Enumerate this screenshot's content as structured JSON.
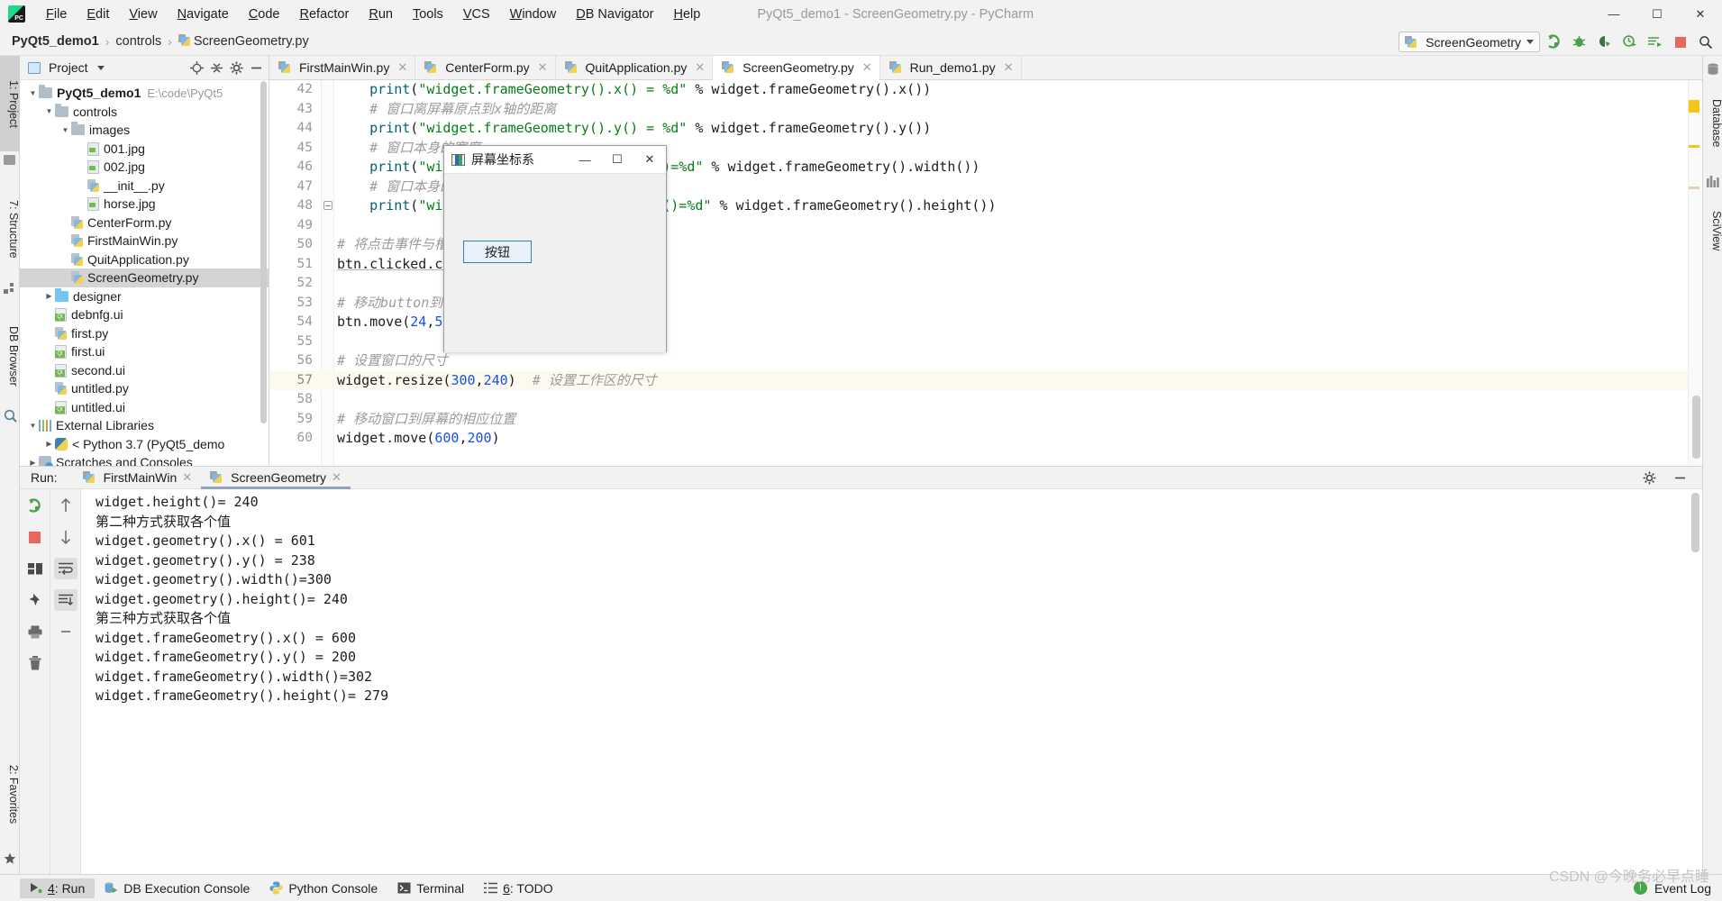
{
  "titlebar": {
    "app_icon": "pycharm-logo-icon",
    "menus": [
      "File",
      "Edit",
      "View",
      "Navigate",
      "Code",
      "Refactor",
      "Run",
      "Tools",
      "VCS",
      "Window",
      "DB Navigator",
      "Help"
    ],
    "window_title": "PyQt5_demo1 - ScreenGeometry.py - PyCharm",
    "minimize": "—",
    "maximize": "☐",
    "close": "✕"
  },
  "navbar": {
    "breadcrumbs": [
      "PyQt5_demo1",
      "controls",
      "ScreenGeometry.py"
    ],
    "separator": "›",
    "run_config": {
      "name": "ScreenGeometry",
      "dropdown": "▾"
    },
    "toolbar_icons": [
      "run-icon",
      "debug-icon",
      "coverage-icon",
      "profile-icon",
      "run-with-console-icon",
      "stop-icon",
      "search-everywhere-icon"
    ]
  },
  "left_strip": {
    "tabs": [
      "1: Project",
      "7: Structure",
      "DB Browser",
      "2: Favorites"
    ]
  },
  "right_strip": {
    "tabs": [
      "Database",
      "SciView"
    ]
  },
  "project_panel": {
    "title": "Project",
    "dropdown": "▾",
    "header_icons": [
      "locate-icon",
      "collapse-all-icon",
      "settings-gear-icon",
      "hide-icon"
    ],
    "tree": [
      {
        "label": "PyQt5_demo1",
        "path": "E:\\code\\PyQt5",
        "icon": "folder-icon",
        "depth": 0,
        "arrow": "▼",
        "bold": true,
        "selected": false
      },
      {
        "label": "controls",
        "path": "",
        "icon": "folder-icon",
        "depth": 1,
        "arrow": "▼",
        "bold": false,
        "selected": false
      },
      {
        "label": "images",
        "path": "",
        "icon": "folder-icon",
        "depth": 2,
        "arrow": "▼",
        "bold": false,
        "selected": false
      },
      {
        "label": "001.jpg",
        "path": "",
        "icon": "image-file-icon",
        "depth": 3,
        "arrow": "",
        "bold": false,
        "selected": false
      },
      {
        "label": "002.jpg",
        "path": "",
        "icon": "image-file-icon",
        "depth": 3,
        "arrow": "",
        "bold": false,
        "selected": false
      },
      {
        "label": "__init__.py",
        "path": "",
        "icon": "python-file-icon",
        "depth": 3,
        "arrow": "",
        "bold": false,
        "selected": false
      },
      {
        "label": "horse.jpg",
        "path": "",
        "icon": "image-file-icon",
        "depth": 3,
        "arrow": "",
        "bold": false,
        "selected": false
      },
      {
        "label": "CenterForm.py",
        "path": "",
        "icon": "python-file-icon",
        "depth": 2,
        "arrow": "",
        "bold": false,
        "selected": false
      },
      {
        "label": "FirstMainWin.py",
        "path": "",
        "icon": "python-file-icon",
        "depth": 2,
        "arrow": "",
        "bold": false,
        "selected": false
      },
      {
        "label": "QuitApplication.py",
        "path": "",
        "icon": "python-file-icon",
        "depth": 2,
        "arrow": "",
        "bold": false,
        "selected": false
      },
      {
        "label": "ScreenGeometry.py",
        "path": "",
        "icon": "python-file-icon",
        "depth": 2,
        "arrow": "",
        "bold": false,
        "selected": true
      },
      {
        "label": "designer",
        "path": "",
        "icon": "folder-blue-icon",
        "depth": 1,
        "arrow": "▶",
        "bold": false,
        "selected": false
      },
      {
        "label": "debnfg.ui",
        "path": "",
        "icon": "qt-ui-file-icon",
        "depth": 1,
        "arrow": "",
        "bold": false,
        "selected": false
      },
      {
        "label": "first.py",
        "path": "",
        "icon": "python-file-icon",
        "depth": 1,
        "arrow": "",
        "bold": false,
        "selected": false
      },
      {
        "label": "first.ui",
        "path": "",
        "icon": "qt-ui-file-icon",
        "depth": 1,
        "arrow": "",
        "bold": false,
        "selected": false
      },
      {
        "label": "second.ui",
        "path": "",
        "icon": "qt-ui-file-icon",
        "depth": 1,
        "arrow": "",
        "bold": false,
        "selected": false
      },
      {
        "label": "untitled.py",
        "path": "",
        "icon": "python-file-icon",
        "depth": 1,
        "arrow": "",
        "bold": false,
        "selected": false
      },
      {
        "label": "untitled.ui",
        "path": "",
        "icon": "qt-ui-file-icon",
        "depth": 1,
        "arrow": "",
        "bold": false,
        "selected": false
      },
      {
        "label": "External Libraries",
        "path": "",
        "icon": "libraries-icon",
        "depth": 0,
        "arrow": "▼",
        "bold": false,
        "selected": false
      },
      {
        "label": "< Python 3.7 (PyQt5_demo",
        "path": "",
        "icon": "python-interpreter-icon",
        "depth": 1,
        "arrow": "▶",
        "bold": false,
        "selected": false
      },
      {
        "label": "Scratches and Consoles",
        "path": "",
        "icon": "scratches-icon",
        "depth": 0,
        "arrow": "▶",
        "bold": false,
        "selected": false
      }
    ]
  },
  "editor": {
    "tabs": [
      {
        "label": "FirstMainWin.py",
        "active": false,
        "close": "✕"
      },
      {
        "label": "CenterForm.py",
        "active": false,
        "close": "✕"
      },
      {
        "label": "QuitApplication.py",
        "active": false,
        "close": "✕"
      },
      {
        "label": "ScreenGeometry.py",
        "active": true,
        "close": "✕"
      },
      {
        "label": "Run_demo1.py",
        "active": false,
        "close": "✕"
      }
    ],
    "lines": [
      {
        "n": "42",
        "highlight": false,
        "fold": false,
        "segs": [
          {
            "t": "    ",
            "c": "plain"
          },
          {
            "t": "print",
            "c": "fn"
          },
          {
            "t": "(",
            "c": "plain"
          },
          {
            "t": "\"widget.frameGeometry().x() = %d\"",
            "c": "str"
          },
          {
            "t": " % widget.frameGeometry().x())",
            "c": "plain"
          }
        ]
      },
      {
        "n": "43",
        "highlight": false,
        "fold": false,
        "segs": [
          {
            "t": "    # 窗口离屏幕原点到x轴的距离",
            "c": "cmt"
          }
        ]
      },
      {
        "n": "44",
        "highlight": false,
        "fold": false,
        "segs": [
          {
            "t": "    ",
            "c": "plain"
          },
          {
            "t": "print",
            "c": "fn"
          },
          {
            "t": "(",
            "c": "plain"
          },
          {
            "t": "\"widget.frameGeometry().y() = %d\"",
            "c": "str"
          },
          {
            "t": " % widget.frameGeometry().y())",
            "c": "plain"
          }
        ]
      },
      {
        "n": "45",
        "highlight": false,
        "fold": false,
        "segs": [
          {
            "t": "    # 窗口本身的宽度",
            "c": "cmt"
          }
        ]
      },
      {
        "n": "46",
        "highlight": false,
        "fold": false,
        "segs": [
          {
            "t": "    ",
            "c": "plain"
          },
          {
            "t": "print",
            "c": "fn"
          },
          {
            "t": "(",
            "c": "plain"
          },
          {
            "t": "\"widget.frameGeometry().width()=%d\"",
            "c": "str"
          },
          {
            "t": " % widget.frameGeometry().width())",
            "c": "plain"
          }
        ]
      },
      {
        "n": "47",
        "highlight": false,
        "fold": false,
        "segs": [
          {
            "t": "    # 窗口本身的高度",
            "c": "cmt"
          }
        ]
      },
      {
        "n": "48",
        "highlight": false,
        "fold": true,
        "segs": [
          {
            "t": "    ",
            "c": "plain"
          },
          {
            "t": "print",
            "c": "fn"
          },
          {
            "t": "(",
            "c": "plain"
          },
          {
            "t": "\"widget.frameGeometry().height()=%d\"",
            "c": "str"
          },
          {
            "t": " % widget.frameGeometry().height())",
            "c": "plain"
          }
        ]
      },
      {
        "n": "49",
        "highlight": false,
        "fold": false,
        "segs": []
      },
      {
        "n": "50",
        "highlight": false,
        "fold": false,
        "segs": [
          {
            "t": "# 将点击事件与槽绑定",
            "c": "cmt"
          }
        ]
      },
      {
        "n": "51",
        "highlight": false,
        "fold": false,
        "segs": [
          {
            "t": "btn.clicked.connect(onC",
            "c": "plain underl"
          }
        ]
      },
      {
        "n": "52",
        "highlight": false,
        "fold": false,
        "segs": []
      },
      {
        "n": "53",
        "highlight": false,
        "fold": false,
        "segs": [
          {
            "t": "# 移动button到窗口内的相应",
            "c": "cmt"
          }
        ]
      },
      {
        "n": "54",
        "highlight": false,
        "fold": false,
        "segs": [
          {
            "t": "btn.move(",
            "c": "plain"
          },
          {
            "t": "24",
            "c": "num-lit"
          },
          {
            "t": ",",
            "c": "plain"
          },
          {
            "t": "52",
            "c": "num-lit"
          },
          {
            "t": ")",
            "c": "plain"
          }
        ]
      },
      {
        "n": "55",
        "highlight": false,
        "fold": false,
        "segs": []
      },
      {
        "n": "56",
        "highlight": false,
        "fold": false,
        "segs": [
          {
            "t": "# 设置窗口的尺寸",
            "c": "cmt"
          }
        ]
      },
      {
        "n": "57",
        "highlight": true,
        "fold": false,
        "segs": [
          {
            "t": "widget.resize(",
            "c": "plain"
          },
          {
            "t": "300",
            "c": "num-lit"
          },
          {
            "t": ",",
            "c": "plain"
          },
          {
            "t": "240",
            "c": "num-lit"
          },
          {
            "t": ")  ",
            "c": "plain"
          },
          {
            "t": "# 设置工作区的尺寸",
            "c": "cmt"
          }
        ]
      },
      {
        "n": "58",
        "highlight": false,
        "fold": false,
        "segs": []
      },
      {
        "n": "59",
        "highlight": false,
        "fold": false,
        "segs": [
          {
            "t": "# 移动窗口到屏幕的相应位置",
            "c": "cmt"
          }
        ]
      },
      {
        "n": "60",
        "highlight": false,
        "fold": false,
        "segs": [
          {
            "t": "widget.move(",
            "c": "plain"
          },
          {
            "t": "600",
            "c": "num-lit"
          },
          {
            "t": ",",
            "c": "plain"
          },
          {
            "t": "200",
            "c": "num-lit"
          },
          {
            "t": ")",
            "c": "plain"
          }
        ]
      }
    ]
  },
  "qt_window": {
    "title": "屏幕坐标系",
    "minimize": "—",
    "maximize": "☐",
    "close": "✕",
    "button_label": "按钮"
  },
  "run_window": {
    "label": "Run:",
    "tabs": [
      {
        "label": "FirstMainWin",
        "active": false,
        "close": "✕"
      },
      {
        "label": "ScreenGeometry",
        "active": true,
        "close": "✕"
      }
    ],
    "header_icons": [
      "settings-gear-icon",
      "hide-icon"
    ],
    "sidebar_icons": [
      "rerun-icon",
      "stop-icon",
      "layout-icon",
      "pin-icon",
      "print-icon",
      "trash-icon"
    ],
    "sidebar2_icons": [
      "scroll-up-icon",
      "scroll-down-icon",
      "soft-wrap-icon",
      "scroll-to-end-icon",
      "collapse-icon"
    ],
    "console_lines": [
      "widget.height()= 240",
      "第二种方式获取各个值",
      "widget.geometry().x() = 601",
      "widget.geometry().y() = 238",
      "widget.geometry().width()=300",
      "widget.geometry().height()= 240",
      "第三种方式获取各个值",
      "widget.frameGeometry().x() = 600",
      "widget.frameGeometry().y() = 200",
      "widget.frameGeometry().width()=302",
      "widget.frameGeometry().height()= 279"
    ]
  },
  "statusbar": {
    "items": [
      {
        "label": "4: Run",
        "icon": "run-arrow-icon",
        "selected": true
      },
      {
        "label": "DB Execution Console",
        "icon": "db-console-icon",
        "selected": false
      },
      {
        "label": "Python Console",
        "icon": "python-console-icon",
        "selected": false
      },
      {
        "label": "Terminal",
        "icon": "terminal-icon",
        "selected": false
      },
      {
        "label": "6: TODO",
        "icon": "todo-list-icon",
        "selected": false
      }
    ],
    "event_log": "Event Log",
    "event_log_icon": "event-log-icon",
    "watermark": "CSDN @今晚务必早点睡"
  },
  "colors": {
    "accent_blue": "#2d7dc4",
    "comment_gray": "#9b9b9b",
    "string_green": "#067d17",
    "number_blue": "#1750eb",
    "selection_gray": "#d4d4d4",
    "highlight_line": "#fcfaef",
    "panel_bg": "#f2f2f2"
  }
}
